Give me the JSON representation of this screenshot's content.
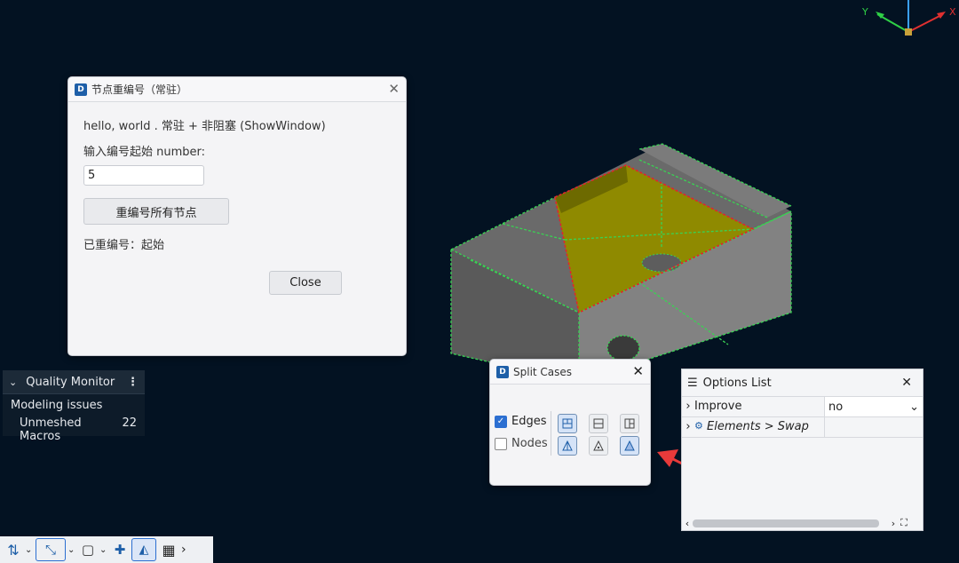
{
  "axes": {
    "x_label": "X",
    "y_label": "Y"
  },
  "renumber_dialog": {
    "title": "节点重编号（常驻）",
    "greeting": "hello, world . 常驻 + 非阻塞 (ShowWindow)",
    "prompt_label": "输入编号起始 number:",
    "start_value": "5",
    "renumber_button": "重编号所有节点",
    "status": "已重编号：起始",
    "close_button": "Close"
  },
  "quality_monitor": {
    "title": "Quality Monitor",
    "section": "Modeling issues",
    "rows": [
      {
        "label": "Unmeshed Macros",
        "count": "22"
      }
    ]
  },
  "split_cases": {
    "title": "Split Cases",
    "rows": [
      {
        "label": "Edges",
        "checked": true
      },
      {
        "label": "Nodes",
        "checked": false
      }
    ]
  },
  "options_list": {
    "title": "Options List",
    "rows": [
      {
        "label": "Improve",
        "value": "no"
      },
      {
        "label": "Elements > Swap",
        "value": ""
      }
    ]
  },
  "toolbar": {
    "icons": [
      "split-icon",
      "select-mode-icon",
      "solid-view-icon",
      "add-node-icon",
      "mesh-shape-icon",
      "grid-icon"
    ]
  },
  "colors": {
    "background": "#031222",
    "highlight_face": "#8f8a00",
    "edge_green": "#39d353",
    "edge_red": "#e0262b",
    "arrow_red": "#e83a3a"
  }
}
